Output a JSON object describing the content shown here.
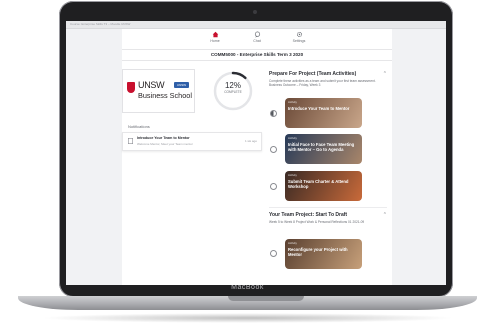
{
  "device": {
    "brand": "MacBook"
  },
  "window": {
    "title": "Course: Enterprise Skills T3 – Moodle UNSW"
  },
  "nav": [
    {
      "label": "Home",
      "icon": "home-icon",
      "color": "#c8102e"
    },
    {
      "label": "Chat",
      "icon": "chat-icon",
      "color": "#6a6d74"
    },
    {
      "label": "Settings",
      "icon": "gear-icon",
      "color": "#6a6d74"
    }
  ],
  "course": {
    "title": "COMM5000 - Enterprise Skills Term 3 2020"
  },
  "logo": {
    "name": "UNSW",
    "school": "Business School",
    "tag": "UNSW"
  },
  "progress": {
    "percent": 12,
    "value_text": "12",
    "unit": "%",
    "caption": "COMPLETE"
  },
  "notifications": {
    "heading": "Notifications",
    "items": [
      {
        "title": "Introduce Your Team to Mentor",
        "subtitle": "Welcome Mentor, Meet your Team mentor",
        "date": "1 wk ago"
      }
    ]
  },
  "sections": [
    {
      "title": "Prepare For Project (Team Activities)",
      "description": "Complete these activities as a team and submit your first team assessment. Business Outcome – Friday, Week 3",
      "cards": [
        {
          "caption": "Activity",
          "title": "Introduce Your Team to Mentor",
          "status": "in-progress",
          "gradient": [
            "#6b4a38",
            "#c9a68a"
          ]
        },
        {
          "caption": "Activity",
          "title": "Initial Face to Face Team Meeting with Mentor – Go to Agenda",
          "status": "not-started",
          "gradient": [
            "#273a58",
            "#a9866a"
          ]
        },
        {
          "caption": "Activity",
          "title": "Submit Team Charter & Attend Workshop",
          "status": "not-started",
          "gradient": [
            "#3a2a24",
            "#c96a3a"
          ]
        }
      ]
    },
    {
      "title": "Your Team Project: Start To Draft",
      "description": "Week 5 to Week 8 Project Work & Personal Reflections 01 2021-09",
      "cards": [
        {
          "caption": "Activity",
          "title": "Reconfigure your Project with Mentor",
          "status": "not-started",
          "gradient": [
            "#5a4030",
            "#c7a07a"
          ]
        }
      ]
    }
  ]
}
